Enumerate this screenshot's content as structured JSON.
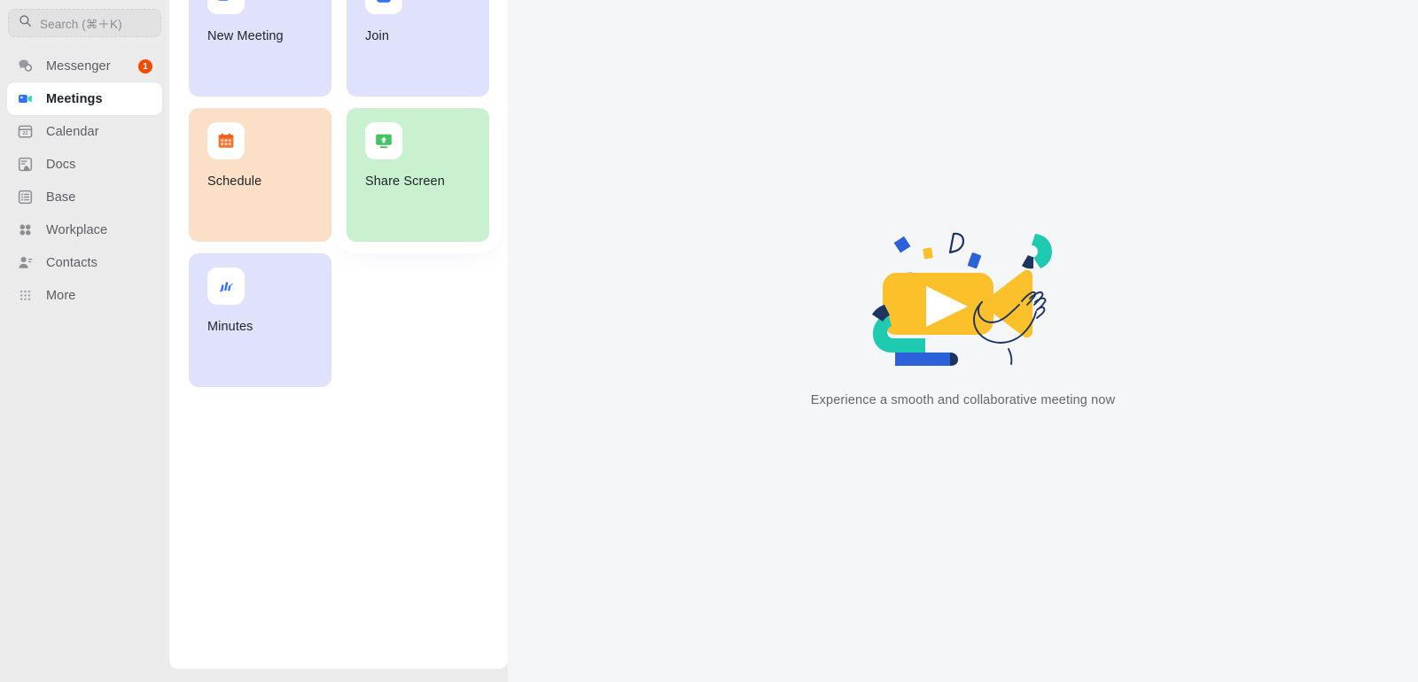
{
  "sidebar": {
    "search": {
      "placeholder": "Search (⌘＋K)",
      "icon": "search-icon",
      "value": ""
    },
    "items": [
      {
        "label": "Messenger",
        "icon": "chat-bubbles-icon",
        "badge": "1",
        "active": false
      },
      {
        "label": "Meetings",
        "icon": "video-camera-icon",
        "badge": "",
        "active": true
      },
      {
        "label": "Calendar",
        "icon": "calendar-icon",
        "badge": "",
        "active": false
      },
      {
        "label": "Docs",
        "icon": "document-icon",
        "badge": "",
        "active": false
      },
      {
        "label": "Base",
        "icon": "list-table-icon",
        "badge": "",
        "active": false
      },
      {
        "label": "Workplace",
        "icon": "four-dots-grid-icon",
        "badge": "",
        "active": false
      },
      {
        "label": "Contacts",
        "icon": "person-icon",
        "badge": "",
        "active": false
      },
      {
        "label": "More",
        "icon": "nine-dots-grid-icon",
        "badge": "",
        "active": false
      }
    ]
  },
  "actions": {
    "cards": [
      {
        "label": "New Meeting",
        "icon": "video-camera-icon",
        "theme": "indigo",
        "elevated": false
      },
      {
        "label": "Join",
        "icon": "plus-square-icon",
        "theme": "indigo",
        "elevated": false
      },
      {
        "label": "Schedule",
        "icon": "calendar-orange-icon",
        "theme": "peach",
        "elevated": false
      },
      {
        "label": "Share Screen",
        "icon": "screen-share-icon",
        "theme": "green",
        "elevated": true
      },
      {
        "label": "Minutes",
        "icon": "brush-strokes-icon",
        "theme": "indigo",
        "elevated": false
      }
    ]
  },
  "empty_state": {
    "illustration": "video-camera-confetti-hand-illustration",
    "message": "Experience a smooth and collaborative meeting now"
  },
  "colors": {
    "sidebar_bg": "#ebebeb",
    "panel_bg": "#ffffff",
    "right_bg": "#f5f6f8",
    "accent_blue": "#3370ff",
    "badge_orange": "#f54a00",
    "card_indigo": "#dfe2fa",
    "card_peach": "#fbe0c7",
    "card_green": "#c9f0cf",
    "illustration_yellow": "#fbc02a",
    "illustration_teal": "#1ecab0",
    "illustration_blue": "#2b62d9",
    "illustration_navy": "#1d3461"
  }
}
